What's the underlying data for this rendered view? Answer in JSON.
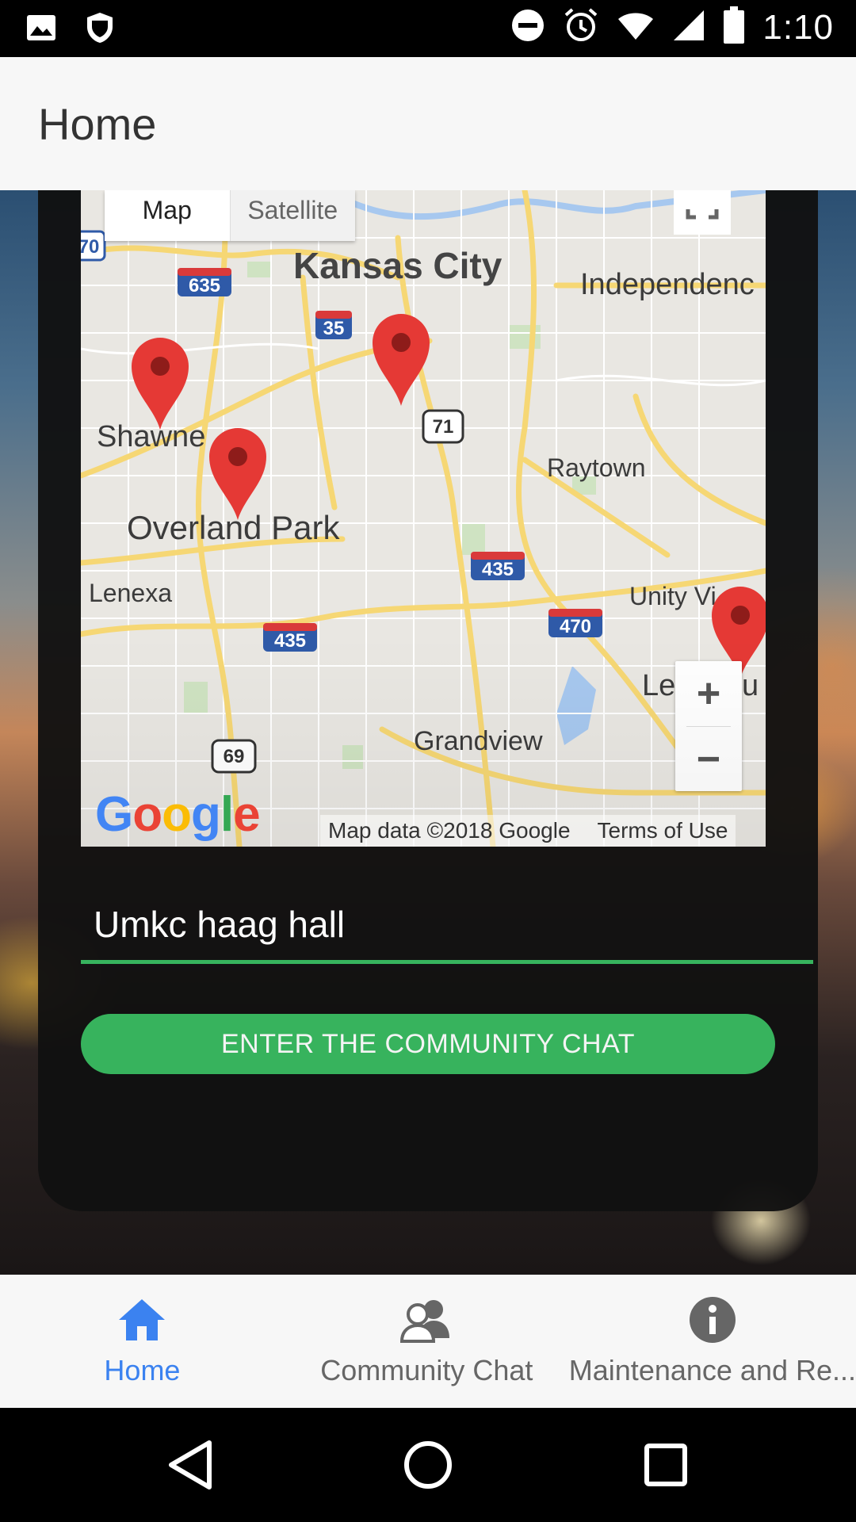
{
  "status_bar": {
    "time": "1:10",
    "left_icons": [
      "image-icon",
      "shield-icon"
    ],
    "right_icons": [
      "do-not-disturb-icon",
      "alarm-icon",
      "wifi-icon",
      "signal-icon",
      "battery-icon"
    ]
  },
  "app_bar": {
    "title": "Home"
  },
  "map": {
    "type_control": {
      "map_label": "Map",
      "satellite_label": "Satellite"
    },
    "labels": {
      "kansas_city": "Kansas City",
      "independence": "Independenc",
      "shawnee": "Shawne",
      "overland_park": "Overland Park",
      "raytown": "Raytown",
      "lenexa": "Lenexa",
      "unity_village": "Unity Vi",
      "grandview": "Grandview",
      "lees_summit": "Le",
      "lees_summit_end": "u"
    },
    "highway_shields": [
      "70",
      "635",
      "35",
      "71",
      "435",
      "470",
      "435",
      "69"
    ],
    "zoom_in_label": "+",
    "zoom_out_label": "−",
    "google_logo": "Google",
    "attribution": "Map data ©2018 Google",
    "terms": "Terms of Use",
    "pin_color": "#e53935"
  },
  "location_input": {
    "value": "Umkc haag hall"
  },
  "enter_button": {
    "label": "ENTER THE COMMUNITY CHAT",
    "color": "#37b35d"
  },
  "bottom_nav": {
    "items": [
      {
        "label": "Home",
        "icon": "home-icon",
        "active": true
      },
      {
        "label": "Community Chat",
        "icon": "people-icon",
        "active": false
      },
      {
        "label": "Maintenance and Re...",
        "icon": "info-icon",
        "active": false
      }
    ],
    "active_color": "#3b82f0"
  },
  "system_nav": {
    "icons": [
      "back-icon",
      "home-circle-icon",
      "recents-icon"
    ]
  }
}
